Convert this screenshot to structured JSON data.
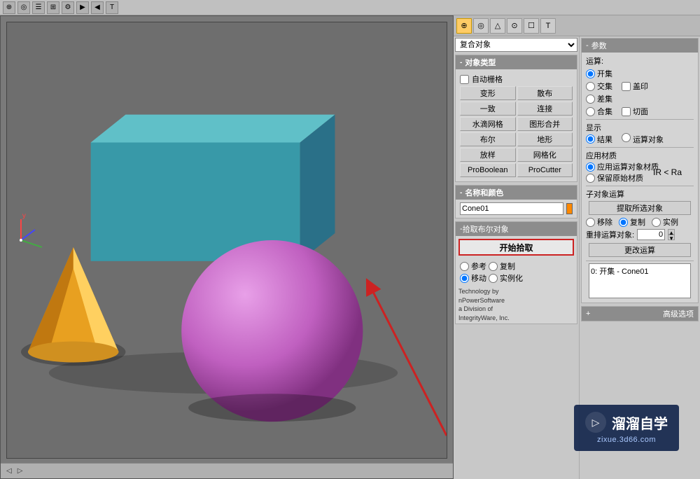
{
  "toolbar": {
    "icons": [
      "⊕",
      "◎",
      "☰",
      "⊞",
      "⚙",
      "▶",
      "◀",
      "T"
    ]
  },
  "viewport": {
    "bottom_nav": "◁ ▷"
  },
  "left_panel": {
    "compound_dropdown_label": "复合对象",
    "object_type_header": "对象类型",
    "auto_grid_label": "自动栅格",
    "buttons": [
      {
        "label": "变形",
        "key": "morph"
      },
      {
        "label": "散布",
        "key": "scatter"
      },
      {
        "label": "一致",
        "key": "conform"
      },
      {
        "label": "连接",
        "key": "connect"
      },
      {
        "label": "水滴网格",
        "key": "blobmesh"
      },
      {
        "label": "图形合并",
        "key": "shapeMerge"
      },
      {
        "label": "布尔",
        "key": "boolean"
      },
      {
        "label": "地形",
        "key": "terrain"
      },
      {
        "label": "放样",
        "key": "loft"
      },
      {
        "label": "网格化",
        "key": "mesher"
      },
      {
        "label": "ProBoolean",
        "key": "proboolean"
      },
      {
        "label": "ProCutter",
        "key": "procutter"
      }
    ],
    "name_color_header": "名称和颜色",
    "name_value": "Cone01",
    "pick_header": "拾取布尔对象",
    "pick_btn_label": "开始拾取",
    "radio_ref": "参考",
    "radio_copy": "复制",
    "radio_move": "移动",
    "radio_instance": "实例化",
    "tech_text": "Technology by\nnPowerSoftware\na Division of\nIntegrityWare, Inc."
  },
  "right_panel": {
    "params_header": "参数",
    "operation_header": "运算:",
    "union_label": "开集",
    "intersection_label": "交集",
    "difference_label": "差集",
    "merge_label": "合集",
    "stamp_label": "盖印",
    "cut_label": "切面",
    "display_header": "显示",
    "result_label": "结果",
    "operands_label": "运算对象",
    "material_header": "应用材质",
    "apply_op_material": "应用运算对象材质",
    "keep_original": "保留原始材质",
    "sub_op_header": "子对象运算",
    "select_btn": "提取所选对象",
    "remove_label": "移除",
    "copy_label": "复制",
    "instance_label": "实例",
    "reorder_label": "重排运算对象:",
    "reorder_value": "0",
    "change_op_btn": "更改运算",
    "list_item": "0: 开集 - Cone01",
    "advanced_header": "高级选项",
    "ir_ra_label": "IR < Ra"
  },
  "watermark": {
    "icon": "▷",
    "title": "溜溜自学",
    "url": "zixue.3d66.com"
  }
}
